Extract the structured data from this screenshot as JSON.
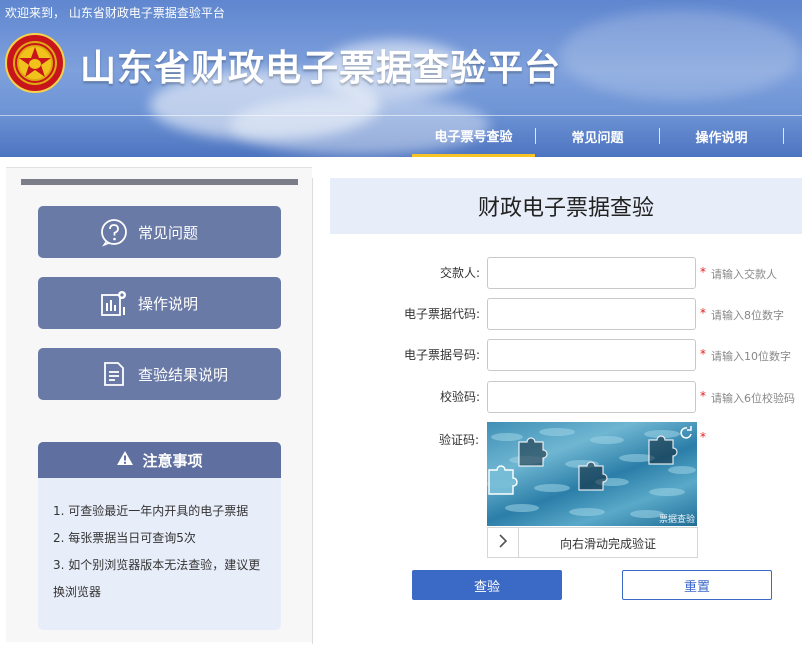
{
  "header": {
    "welcome": "欢迎来到， 山东省财政电子票据查验平台",
    "title": "山东省财政电子票据查验平台",
    "nav": [
      {
        "label": "电子票号查验",
        "active": true
      },
      {
        "label": "常见问题",
        "active": false
      },
      {
        "label": "操作说明",
        "active": false
      }
    ]
  },
  "sidebar": {
    "buttons": [
      {
        "label": "常见问题",
        "icon": "question-icon"
      },
      {
        "label": "操作说明",
        "icon": "chart-gear-icon"
      },
      {
        "label": "查验结果说明",
        "icon": "document-icon"
      }
    ],
    "notice": {
      "title": "注意事项",
      "items": [
        "1. 可查验最近一年内开具的电子票据",
        "2. 每张票据当日可查询5次",
        "3. 如个别浏览器版本无法查验，建议更换浏览器"
      ]
    }
  },
  "main": {
    "title": "财政电子票据查验",
    "fields": [
      {
        "label": "交款人:",
        "value": "",
        "hint": "请输入交款人"
      },
      {
        "label": "电子票据代码:",
        "value": "",
        "hint": "请输入8位数字"
      },
      {
        "label": "电子票据号码:",
        "value": "",
        "hint": "请输入10位数字"
      },
      {
        "label": "校验码:",
        "value": "",
        "hint": "请输入6位校验码"
      }
    ],
    "captcha": {
      "label": "验证码:",
      "slider_text": "向右滑动完成验证",
      "watermark": "票据查验"
    },
    "buttons": {
      "check": "查验",
      "reset": "重置"
    },
    "colors": {
      "primary": "#3b69c6",
      "required": "#e02020",
      "accent": "#f7c325"
    }
  }
}
